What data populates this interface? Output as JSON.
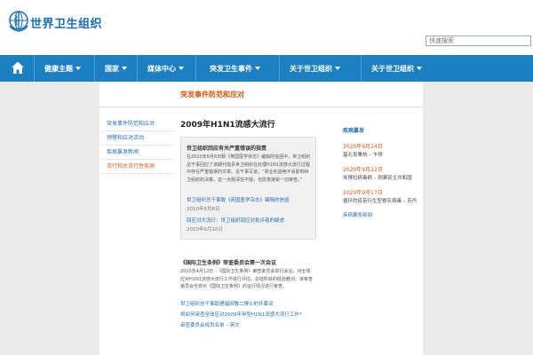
{
  "header": {
    "site_title": "世界卫生组织",
    "search_placeholder": "快速搜索"
  },
  "nav": {
    "items": [
      {
        "label": "健康主题"
      },
      {
        "label": "国家"
      },
      {
        "label": "媒体中心"
      },
      {
        "label": "突发卫生事件"
      },
      {
        "label": "关于世卫组织"
      },
      {
        "label": "关于世卫组织"
      }
    ]
  },
  "section": {
    "title": "突发事件防范和应对"
  },
  "left_nav": {
    "items": [
      {
        "label": "突发事件防范和应对"
      },
      {
        "label": "预警和应对活动"
      },
      {
        "label": "疾病暴发新闻"
      },
      {
        "label": "流行和大流行性疾病"
      }
    ]
  },
  "main": {
    "heading": "2009年H1N1流感大流行",
    "box": {
      "title": "世卫组织回应有关严重错误的指责",
      "paragraph": "在2010年6月8日致《英国医学杂志》编辑的信函中，世卫组织总干事回应了该期刊指责世卫组织在处理H1N1流感大流行过程中存在严重错误的文章。总干事写道，“商业利益绝不会影响世卫组织的决策，这一点我深信不疑，也愿意接受一切审查。”",
      "link1": "世卫组织总干事致《英国医学杂志》编辑的信函",
      "date1": "2010年6月8日",
      "link2": "回应对大流行：世卫组织回应对批评者的疑虑",
      "date2": "2010年6月10日"
    },
    "lower": {
      "title": "《国际卫生条例》审查委员会第一次会议",
      "paragraph": "2010年4月12日 –《国际卫生条例》审查委员会举行会议，对全球应对H1N1流感大流行工作进行评估，总结所获的经验教训，该审查委员会也将对《国际卫生条例》的运行情况进行审查。",
      "link1": "世卫组织总干事助理福田敬二博士的开幕词",
      "link2": "将如何审查全球应对2009年甲型H1N1流感大流行工作?",
      "link3": "审查委员会成员名单 – 英文"
    }
  },
  "right": {
    "title": "疾病暴发",
    "items": [
      {
        "date": "2020年9月24日",
        "text": "基孔肯雅热 – 乍得"
      },
      {
        "date": "2020年9月22日",
        "text": "埃博拉病毒病 – 刚果民主共和国"
      },
      {
        "date": "2020年9月17日",
        "text": "循环的疫苗衍生型脊灰病毒 – 苏丹"
      }
    ],
    "more": "疾病暴发新闻"
  }
}
